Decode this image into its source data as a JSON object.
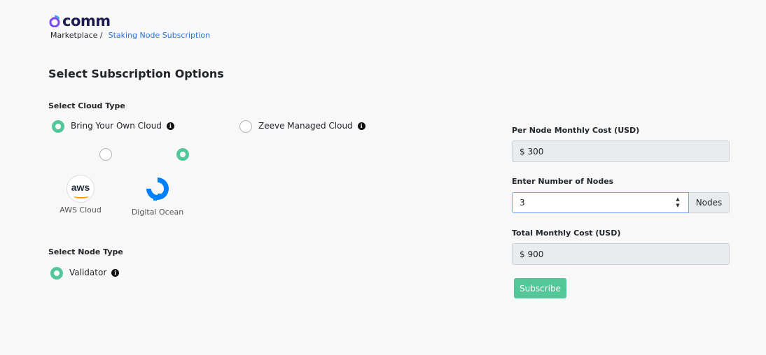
{
  "brand": {
    "name": "comm"
  },
  "breadcrumb": {
    "home": "Marketplace /",
    "current": "Staking Node Subscription"
  },
  "page": {
    "title": "Select Subscription Options"
  },
  "cloud_type": {
    "label": "Select Cloud Type",
    "options": [
      {
        "label": "Bring Your Own Cloud",
        "selected": true
      },
      {
        "label": "Zeeve Managed Cloud",
        "selected": false
      }
    ],
    "providers": [
      {
        "label": "AWS Cloud",
        "logo_text": "aws",
        "selected": false
      },
      {
        "label": "Digital Ocean",
        "selected": true
      }
    ]
  },
  "node_type": {
    "label": "Select Node Type",
    "options": [
      {
        "label": "Validator",
        "selected": true
      }
    ]
  },
  "pricing": {
    "per_node_label": "Per Node Monthly Cost (USD)",
    "per_node_value": "$ 300",
    "nodes_label": "Enter Number of Nodes",
    "nodes_value": "3",
    "nodes_addon": "Nodes",
    "total_label": "Total Monthly Cost (USD)",
    "total_value": "$ 900"
  },
  "actions": {
    "subscribe_label": "Subscribe"
  },
  "colors": {
    "accent": "#52c79a",
    "link": "#2a73d6",
    "brand_dark": "#1b1b4d",
    "brand_purple": "#7b4cf0"
  }
}
